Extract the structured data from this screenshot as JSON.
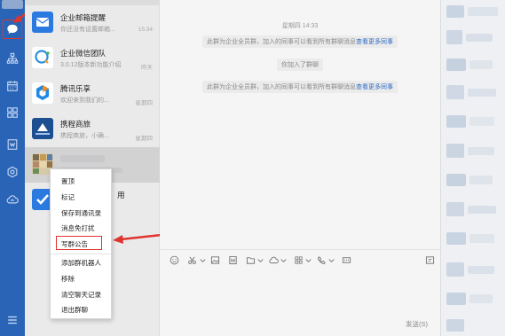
{
  "rail": {
    "icons": [
      "chat-icon",
      "contacts-icon",
      "calendar-icon",
      "apps-icon",
      "doc-icon",
      "settings-icon",
      "cloud-icon",
      "menu-icon"
    ]
  },
  "chat_list": {
    "items": [
      {
        "name": "企业邮箱提醒",
        "sub": "你还没有设置邮箱...",
        "time": "15:34"
      },
      {
        "name": "企业微信团队",
        "sub": "3.0.12版本新功能介绍",
        "time": "昨天"
      },
      {
        "name": "腾讯乐享",
        "sub": "欢迎来到我们的...",
        "time": "星期四"
      },
      {
        "name": "携程商旅",
        "sub": "携程商旅，小确...",
        "time": "星期四"
      },
      {
        "name": "",
        "sub": "",
        "time": ""
      },
      {
        "name": "用",
        "sub": "",
        "time": ""
      }
    ]
  },
  "context_menu": {
    "items": [
      "置顶",
      "标记",
      "保存到通讯录",
      "消息免打扰",
      "写群公告",
      "添加群机器人",
      "移除",
      "清空聊天记录",
      "退出群聊"
    ],
    "highlighted": "写群公告"
  },
  "chat": {
    "timestamp": "星期四 14:33",
    "sys1_text": "此群为企业全员群，加入的同事可以看到所有群聊消息",
    "sys1_link": "查看更多同事",
    "sys2_text": "你加入了群聊",
    "sys3_text": "此群为企业全员群，加入的同事可以看到所有群聊消息",
    "sys3_link": "查看更多同事",
    "send_label": "发送(S)"
  },
  "toolbar": {
    "icons": [
      "emoji-icon",
      "screenshot-icon",
      "image-icon",
      "word-file-icon",
      "folder-icon",
      "cloud-file-icon",
      "more-apps-icon",
      "phone-icon",
      "live-icon",
      "history-icon"
    ]
  },
  "colors": {
    "rail": "#2a64b6",
    "accent_red": "#e0342e",
    "link": "#2f6cc4"
  }
}
